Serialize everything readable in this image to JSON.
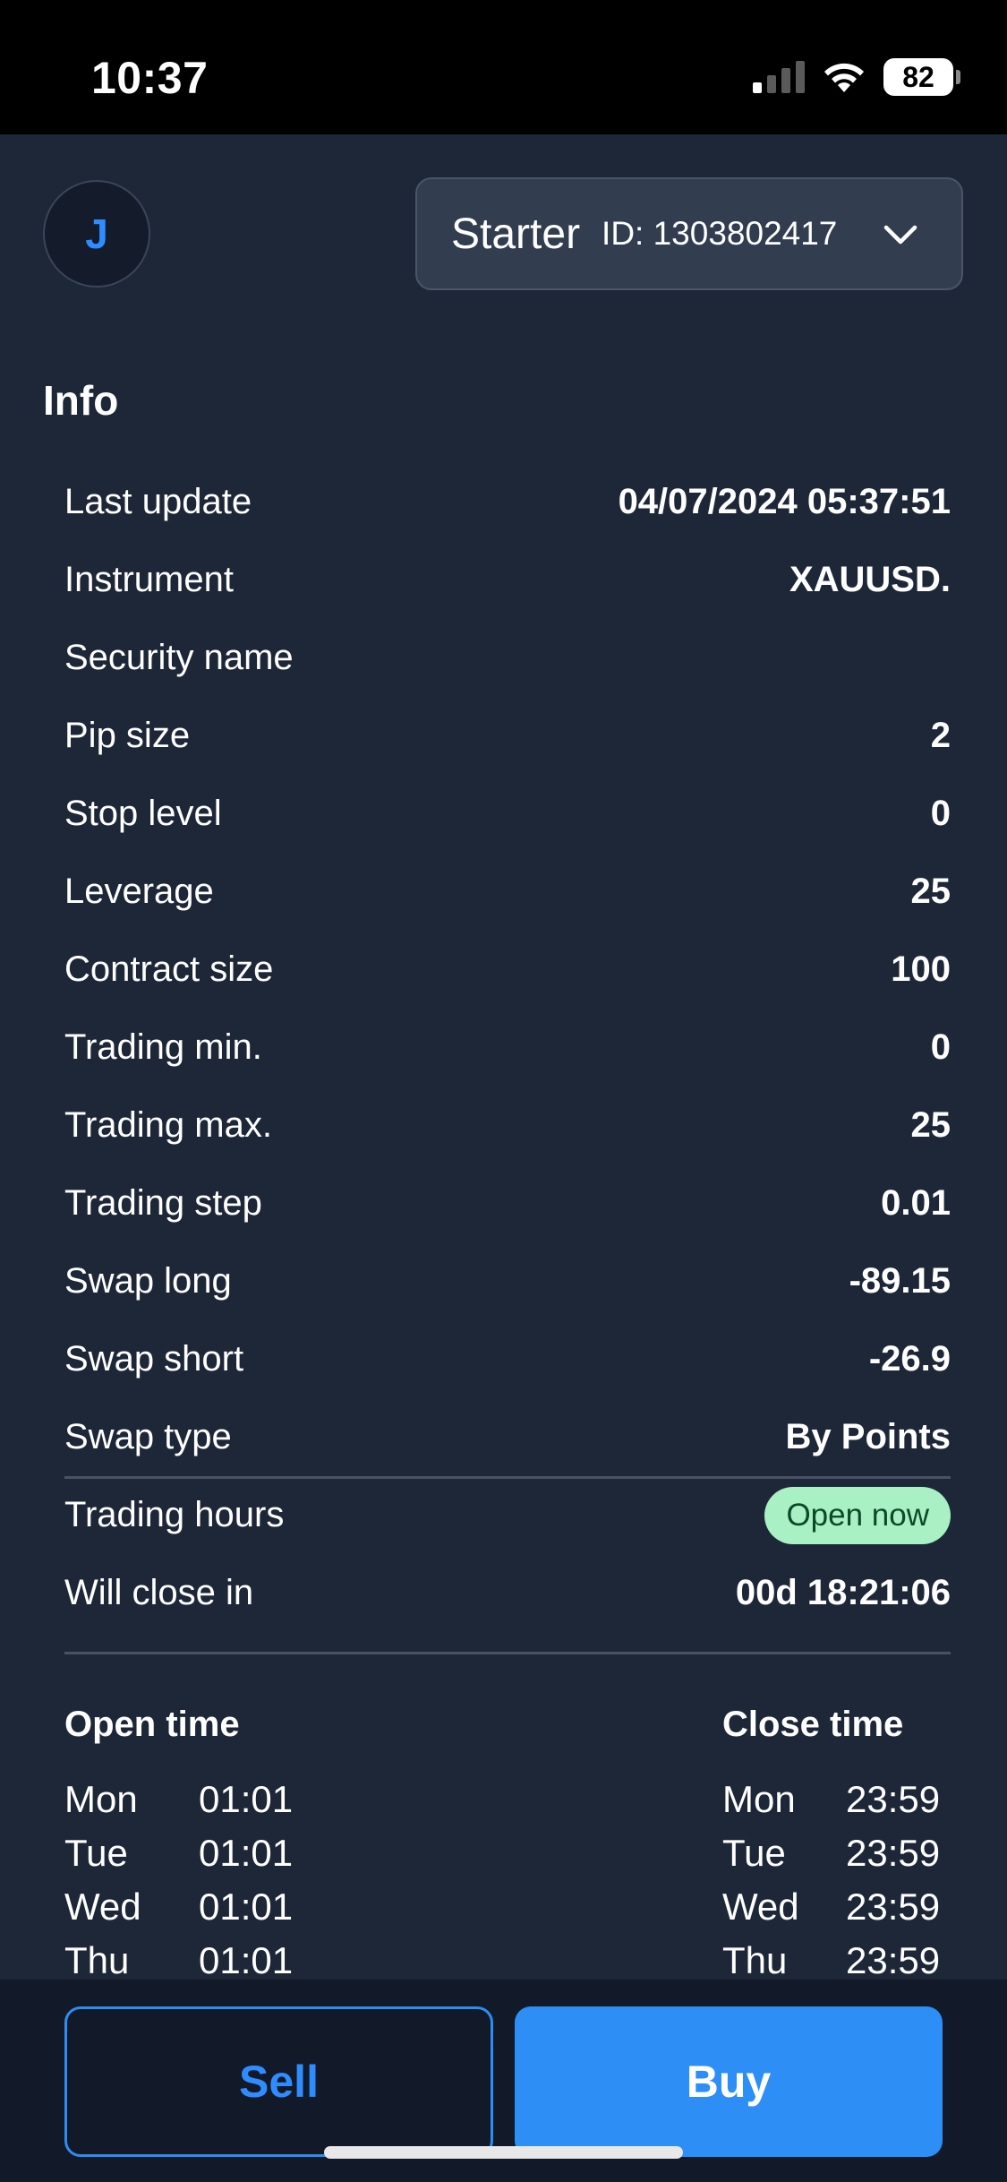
{
  "status_bar": {
    "time": "10:37",
    "battery": "82"
  },
  "header": {
    "avatar_initial": "J",
    "account_type": "Starter",
    "account_id": "ID: 1303802417"
  },
  "info": {
    "title": "Info",
    "rows": [
      {
        "label": "Last update",
        "value": "04/07/2024 05:37:51"
      },
      {
        "label": "Instrument",
        "value": "XAUUSD."
      },
      {
        "label": "Security name",
        "value": ""
      },
      {
        "label": "Pip size",
        "value": "2"
      },
      {
        "label": "Stop level",
        "value": "0"
      },
      {
        "label": "Leverage",
        "value": "25"
      },
      {
        "label": "Contract size",
        "value": "100"
      },
      {
        "label": "Trading min.",
        "value": "0"
      },
      {
        "label": "Trading max.",
        "value": "25"
      },
      {
        "label": "Trading step",
        "value": "0.01"
      },
      {
        "label": "Swap long",
        "value": "-89.15"
      },
      {
        "label": "Swap short",
        "value": "-26.9"
      },
      {
        "label": "Swap type",
        "value": "By Points"
      }
    ]
  },
  "trading_hours": {
    "label": "Trading hours",
    "status": "Open now",
    "status_color": "#a9f0c4",
    "close_label": "Will close in",
    "close_value": "00d 18:21:06"
  },
  "schedule": {
    "open_header": "Open time",
    "close_header": "Close time",
    "open": [
      {
        "day": "Mon",
        "time": "01:01"
      },
      {
        "day": "Tue",
        "time": "01:01"
      },
      {
        "day": "Wed",
        "time": "01:01"
      },
      {
        "day": "Thu",
        "time": "01:01"
      }
    ],
    "close": [
      {
        "day": "Mon",
        "time": "23:59"
      },
      {
        "day": "Tue",
        "time": "23:59"
      },
      {
        "day": "Wed",
        "time": "23:59"
      },
      {
        "day": "Thu",
        "time": "23:59"
      }
    ]
  },
  "actions": {
    "sell": "Sell",
    "buy": "Buy",
    "accent": "#2d8ff5"
  }
}
